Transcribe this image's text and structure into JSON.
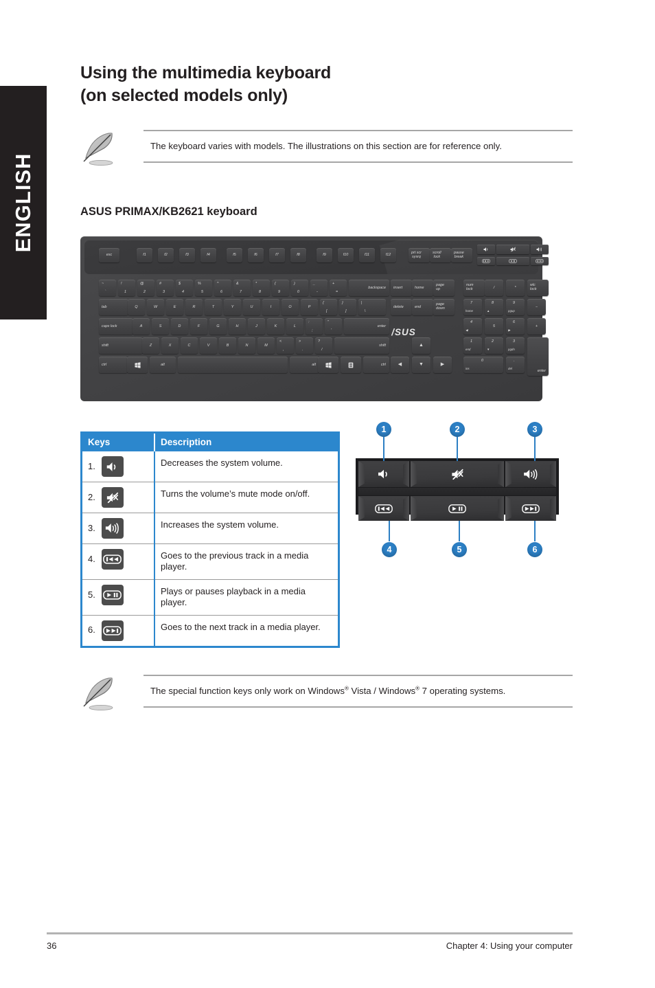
{
  "language_tab": {
    "label": "ENGLISH"
  },
  "heading": {
    "line1": "Using the multimedia keyboard",
    "line2": "(on selected models only)"
  },
  "subheading": "ASUS PRIMAX/KB2621 keyboard",
  "notes": {
    "top": {
      "icon": "quill-pen-icon",
      "text": "The keyboard varies with models. The illustrations on this section are for reference only."
    },
    "bottom": {
      "icon": "quill-pen-icon",
      "text_part1": "The special function keys only work on Windows",
      "sup1": "®",
      "text_part2": " Vista / Windows",
      "sup2": "®",
      "text_part3": " 7 operating systems."
    }
  },
  "keyboard_illustration": {
    "brand": "/SUS",
    "function_row": [
      "esc",
      "f1",
      "f2",
      "f3",
      "f4",
      "f5",
      "f6",
      "f7",
      "f8",
      "f9",
      "f10",
      "f11",
      "f12"
    ],
    "system_keys": [
      {
        "top": "prt scr",
        "bottom": "sysrq"
      },
      {
        "top": "scroll",
        "bottom": "lock"
      },
      {
        "top": "pause",
        "bottom": "break"
      }
    ],
    "number_row": [
      {
        "upper": "~",
        "lower": "`"
      },
      {
        "upper": "!",
        "lower": "1"
      },
      {
        "upper": "@",
        "lower": "2"
      },
      {
        "upper": "#",
        "lower": "3"
      },
      {
        "upper": "$",
        "lower": "4"
      },
      {
        "upper": "%",
        "lower": "5"
      },
      {
        "upper": "^",
        "lower": "6"
      },
      {
        "upper": "&",
        "lower": "7"
      },
      {
        "upper": "*",
        "lower": "8"
      },
      {
        "upper": "(",
        "lower": "9"
      },
      {
        "upper": ")",
        "lower": "0"
      },
      {
        "upper": "_",
        "lower": "-"
      },
      {
        "upper": "+",
        "lower": "="
      }
    ],
    "row_q": [
      "Q",
      "W",
      "E",
      "R",
      "T",
      "Y",
      "U",
      "I",
      "O",
      "P"
    ],
    "row_q_brackets": [
      {
        "upper": "{",
        "lower": "["
      },
      {
        "upper": "}",
        "lower": "]"
      },
      {
        "upper": "|",
        "lower": "\\"
      }
    ],
    "row_a": [
      "A",
      "S",
      "D",
      "F",
      "G",
      "H",
      "J",
      "K",
      "L"
    ],
    "row_a_punct": [
      {
        "upper": ":",
        "lower": ";"
      },
      {
        "upper": "\"",
        "lower": "'"
      }
    ],
    "row_z": [
      "Z",
      "X",
      "C",
      "V",
      "B",
      "N",
      "M"
    ],
    "row_z_punct": [
      {
        "upper": "<",
        "lower": ","
      },
      {
        "upper": ">",
        "lower": "."
      },
      {
        "upper": "?",
        "lower": "/"
      }
    ],
    "modifiers": {
      "tab": "tab",
      "caps_lock": "caps lock",
      "shift_left": "shift",
      "shift_right": "shift",
      "ctrl_left": "ctrl",
      "ctrl_right": "ctrl",
      "alt_left": "alt",
      "alt_right": "alt",
      "backspace": "backspace",
      "enter": "enter",
      "windows": "windows-key-icon",
      "menu": "menu-key-icon"
    },
    "nav_cluster": [
      {
        "top": "insert",
        "bottom": ""
      },
      {
        "top": "home",
        "bottom": ""
      },
      {
        "top": "page",
        "bottom": "up"
      },
      {
        "top": "delete",
        "bottom": ""
      },
      {
        "top": "end",
        "bottom": ""
      },
      {
        "top": "page",
        "bottom": "down"
      }
    ],
    "arrows": [
      "▲",
      "◀",
      "▼",
      "▶"
    ],
    "numpad": [
      {
        "top": "num",
        "bottom": "lock"
      },
      {
        "main": "/"
      },
      {
        "main": "*"
      },
      {
        "top": "wlc",
        "bottom": "lock"
      },
      {
        "main": "7",
        "sub": "home"
      },
      {
        "main": "8",
        "sub": "▲"
      },
      {
        "main": "9",
        "sub": "pgup"
      },
      {
        "main": "−"
      },
      {
        "main": "4",
        "sub": "◀"
      },
      {
        "main": "5"
      },
      {
        "main": "6",
        "sub": "▶"
      },
      {
        "main": "+"
      },
      {
        "main": "1",
        "sub": "end"
      },
      {
        "main": "2",
        "sub": "▼"
      },
      {
        "main": "3",
        "sub": "pgdn"
      },
      {
        "main": "0",
        "sub": "ins"
      },
      {
        "main": ".",
        "sub": "del"
      },
      {
        "main": "enter"
      }
    ],
    "media_strip": [
      "volume-down-icon",
      "mute-icon",
      "volume-up-icon",
      "previous-track-icon",
      "play-pause-icon",
      "next-track-icon"
    ]
  },
  "table": {
    "headers": {
      "keys": "Keys",
      "description": "Description"
    },
    "rows": [
      {
        "num": "1.",
        "icon": "volume-down-icon",
        "description": "Decreases the system volume."
      },
      {
        "num": "2.",
        "icon": "mute-icon",
        "description": "Turns the volume’s mute mode on/off."
      },
      {
        "num": "3.",
        "icon": "volume-up-icon",
        "description": "Increases the system volume."
      },
      {
        "num": "4.",
        "icon": "previous-track-icon",
        "description": "Goes to the previous track in a media player."
      },
      {
        "num": "5.",
        "icon": "play-pause-icon",
        "description": "Plays or pauses playback in a media player."
      },
      {
        "num": "6.",
        "icon": "next-track-icon",
        "description": "Goes to the next track in a media player."
      }
    ]
  },
  "callout_diagram": {
    "top_bubbles": [
      "1",
      "2",
      "3"
    ],
    "bottom_bubbles": [
      "4",
      "5",
      "6"
    ],
    "keys": [
      {
        "index": "1",
        "icon": "volume-down-icon"
      },
      {
        "index": "2",
        "icon": "mute-icon"
      },
      {
        "index": "3",
        "icon": "volume-up-icon"
      },
      {
        "index": "4",
        "icon": "previous-track-icon"
      },
      {
        "index": "5",
        "icon": "play-pause-icon"
      },
      {
        "index": "6",
        "icon": "next-track-icon"
      }
    ]
  },
  "footer": {
    "page_number": "36",
    "chapter": "Chapter 4: Using your computer"
  },
  "colors": {
    "accent_blue": "#2c87cd",
    "bubble_blue": "#2c7fc4",
    "tab_black": "#231f20",
    "icon_tile_gray": "#4c4c4c",
    "rule_gray": "#a6a6a6"
  }
}
